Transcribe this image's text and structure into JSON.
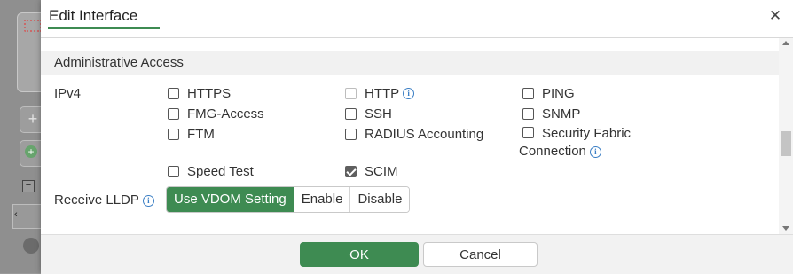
{
  "dialog": {
    "title": "Edit Interface",
    "section_title": "Administrative Access"
  },
  "ipv4": {
    "label": "IPv4",
    "options": [
      {
        "label": "HTTPS",
        "checked": false,
        "disabled": false
      },
      {
        "label": "HTTP",
        "checked": false,
        "disabled": true,
        "info": true
      },
      {
        "label": "PING",
        "checked": false,
        "disabled": false
      },
      {
        "label": "FMG-Access",
        "checked": false,
        "disabled": false
      },
      {
        "label": "SSH",
        "checked": false,
        "disabled": false
      },
      {
        "label": "SNMP",
        "checked": false,
        "disabled": false
      },
      {
        "label": "FTM",
        "checked": false,
        "disabled": false
      },
      {
        "label": "RADIUS Accounting",
        "checked": false,
        "disabled": false
      },
      {
        "label": "Security Fabric Connection",
        "checked": false,
        "disabled": false,
        "info": true
      },
      {
        "label": "Speed Test",
        "checked": false,
        "disabled": false
      },
      {
        "label": "SCIM",
        "checked": true,
        "disabled": false
      }
    ]
  },
  "lldp": {
    "label": "Receive LLDP",
    "options": [
      "Use VDOM Setting",
      "Enable",
      "Disable"
    ],
    "selected": "Use VDOM Setting"
  },
  "footer": {
    "ok_label": "OK",
    "cancel_label": "Cancel"
  },
  "colors": {
    "accent": "#3e8b52",
    "info": "#3a7ec4"
  }
}
